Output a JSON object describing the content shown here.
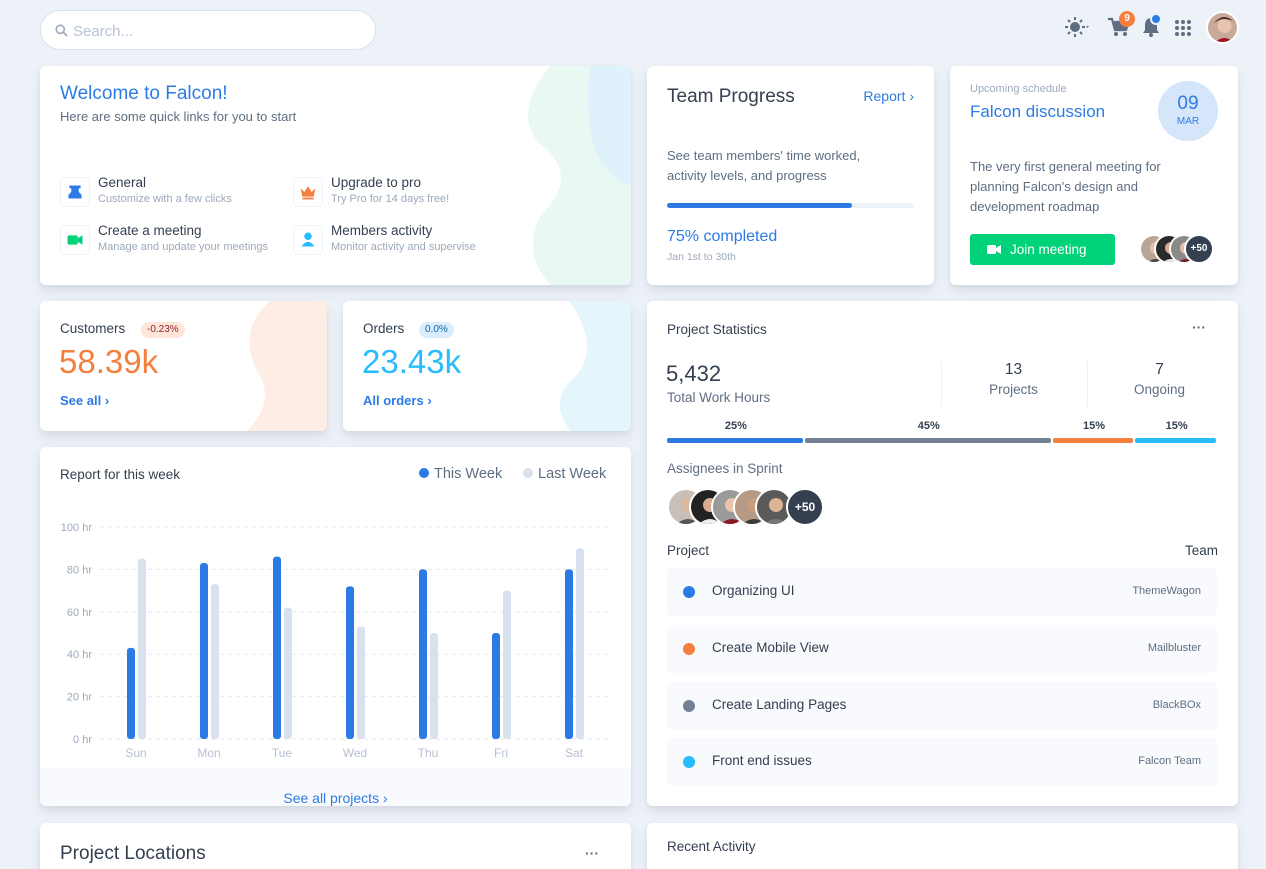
{
  "search": {
    "placeholder": "Search..."
  },
  "topbar": {
    "cart_count": "9"
  },
  "welcome": {
    "title": "Welcome to Falcon!",
    "subtitle": "Here are some quick links for you to start",
    "links": [
      {
        "title": "General",
        "sub": "Customize with a few clicks",
        "icon": "settings-icon",
        "color": "#2c7be5"
      },
      {
        "title": "Upgrade to pro",
        "sub": "Try Pro for 14 days free!",
        "icon": "crown-icon",
        "color": "#f5803e"
      },
      {
        "title": "Create a meeting",
        "sub": "Manage and update your meetings",
        "icon": "video-icon",
        "color": "#00d27a"
      },
      {
        "title": "Members activity",
        "sub": "Monitor activity and supervise",
        "icon": "user-icon",
        "color": "#27bcfd"
      }
    ]
  },
  "team_progress": {
    "title": "Team Progress",
    "link": "Report",
    "description": "See team members' time worked, activity levels, and progress",
    "progress": 75,
    "completed": "75% completed",
    "date_range": "Jan 1st to 30th"
  },
  "schedule": {
    "label": "Upcoming schedule",
    "title": "Falcon discussion",
    "day": "09",
    "month": "MAR",
    "description": "The very first general meeting for planning Falcon's design and development roadmap",
    "button": "Join meeting",
    "extra": "+50"
  },
  "customers": {
    "label": "Customers",
    "badge": "-0.23%",
    "value": "58.39k",
    "link": "See all"
  },
  "orders": {
    "label": "Orders",
    "badge": "0.0%",
    "value": "23.43k",
    "link": "All orders"
  },
  "weekly_report": {
    "title": "Report for this week",
    "legend": [
      "This Week",
      "Last Week"
    ],
    "footer": "See all projects"
  },
  "chart_data": {
    "type": "bar",
    "categories": [
      "Sun",
      "Mon",
      "Tue",
      "Wed",
      "Thu",
      "Fri",
      "Sat"
    ],
    "series": [
      {
        "name": "This Week",
        "values": [
          43,
          83,
          86,
          72,
          80,
          50,
          80
        ],
        "color": "#2c7be5"
      },
      {
        "name": "Last Week",
        "values": [
          85,
          73,
          62,
          53,
          50,
          70,
          90
        ],
        "color": "#d8e2ef"
      }
    ],
    "y_ticks": [
      "100 hr",
      "80 hr",
      "60 hr",
      "40 hr",
      "20 hr",
      "0 hr"
    ],
    "ylim": [
      0,
      100
    ],
    "grid": true
  },
  "project_stats": {
    "title": "Project Statistics",
    "hours": "5,432",
    "hours_label": "Total Work Hours",
    "projects": "13",
    "projects_label": "Projects",
    "ongoing": "7",
    "ongoing_label": "Ongoing",
    "segments": [
      {
        "label": "25%",
        "value": 25,
        "color": "#2c7be5"
      },
      {
        "label": "45%",
        "value": 45,
        "color": "#748194"
      },
      {
        "label": "15%",
        "value": 15,
        "color": "#f5803e"
      },
      {
        "label": "15%",
        "value": 15,
        "color": "#27bcfd"
      }
    ],
    "assignees_label": "Assignees in Sprint",
    "assignees_extra": "+50",
    "project_header": "Project",
    "team_header": "Team",
    "projects_list": [
      {
        "name": "Organizing UI",
        "team": "ThemeWagon",
        "color": "#2c7be5"
      },
      {
        "name": "Create Mobile View",
        "team": "Mailbluster",
        "color": "#f5803e"
      },
      {
        "name": "Create Landing Pages",
        "team": "BlackBOx",
        "color": "#748194"
      },
      {
        "name": "Front end issues",
        "team": "Falcon Team",
        "color": "#27bcfd"
      }
    ]
  },
  "locations": {
    "title": "Project Locations"
  },
  "recent": {
    "title": "Recent Activity"
  }
}
